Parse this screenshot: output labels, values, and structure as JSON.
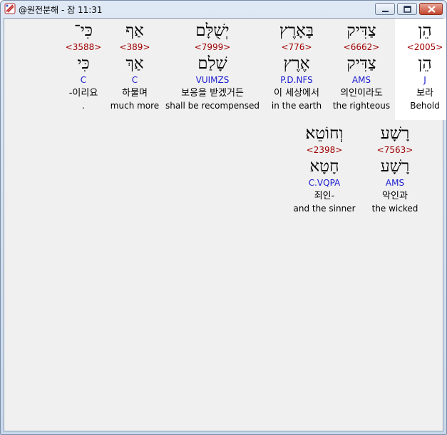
{
  "window": {
    "title": "@원전분해 - 잠 11:31"
  },
  "rows": [
    {
      "words": [
        {
          "hebrew": "הֵן",
          "strong": "<2005>",
          "lemma": "הֵן",
          "parse": "J",
          "korean": "보라",
          "english": "Behold",
          "highlight": true
        },
        {
          "hebrew": "צַדִּיק",
          "strong": "<6662>",
          "lemma": "צַדִּיק",
          "parse": "AMS",
          "korean": "의인이라도",
          "english": "the righteous",
          "highlight": false
        },
        {
          "hebrew": "בָּאָרֶץ",
          "strong": "<776>",
          "lemma": "אֶרֶץ",
          "parse": "P.D.NFS",
          "korean": "이 세상에서",
          "english": "in the earth",
          "highlight": false
        },
        {
          "hebrew": "יְשֻׁלָּם",
          "strong": "<7999>",
          "lemma": "שָׁלַם",
          "parse": "VUIMZS",
          "korean": "보응을 받겠거든",
          "english": "shall be recompensed",
          "highlight": false
        },
        {
          "hebrew": "אַף",
          "strong": "<389>",
          "lemma": "אַךְ",
          "parse": "C",
          "korean": "하물며",
          "english": "much more",
          "highlight": false
        },
        {
          "hebrew": "כִּי־",
          "strong": "<3588>",
          "lemma": "כִּי",
          "parse": "C",
          "korean": "-이리요",
          "english": ".",
          "highlight": false
        }
      ]
    },
    {
      "words": [
        {
          "hebrew": "רָשָׁע",
          "strong": "<7563>",
          "lemma": "רָשָׁע",
          "parse": "AMS",
          "korean": "악인과",
          "english": "the wicked",
          "highlight": false
        },
        {
          "hebrew": "וְחוֹטֵא׃",
          "strong": "<2398>",
          "lemma": "חָטָא",
          "parse": "C.VQPA",
          "korean": "죄인-",
          "english": "and the sinner",
          "highlight": false
        }
      ]
    }
  ]
}
